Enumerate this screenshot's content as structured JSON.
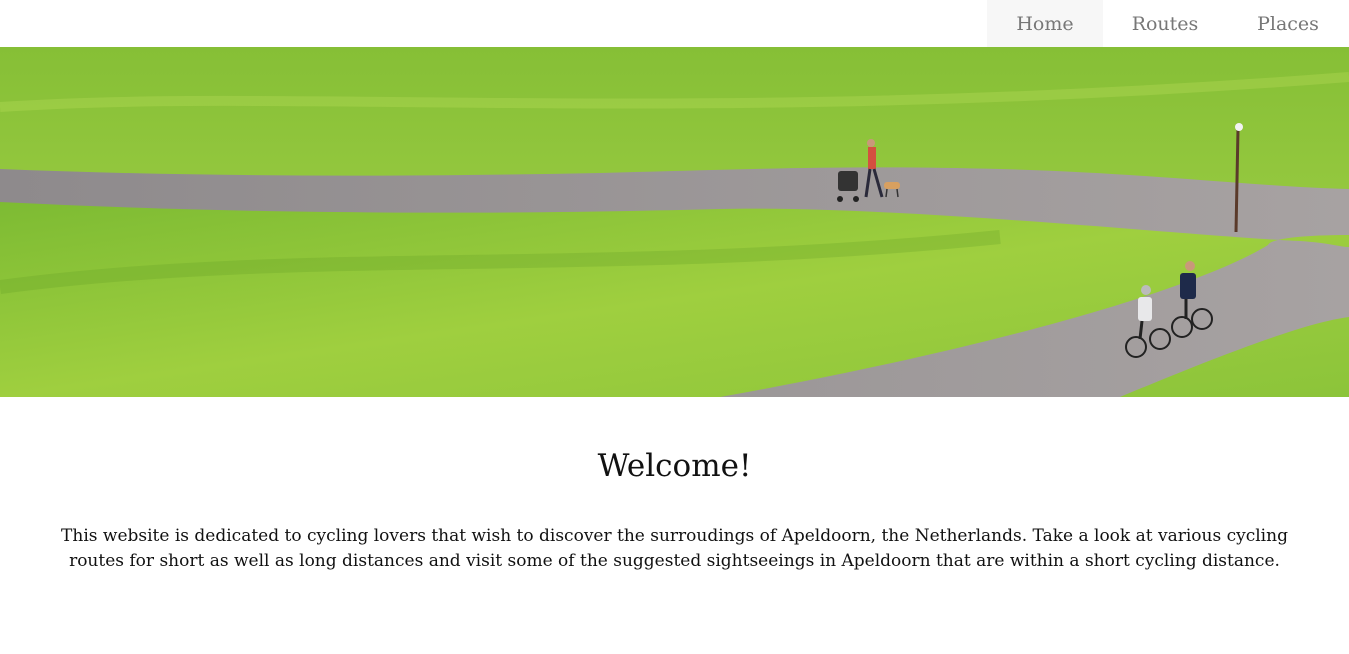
{
  "nav": {
    "items": [
      {
        "label": "Home",
        "active": true
      },
      {
        "label": "Routes",
        "active": false
      },
      {
        "label": "Places",
        "active": false
      }
    ]
  },
  "hero": {
    "image": "grass-hills-bike-path-photo",
    "colors": {
      "grass_light": "#9fcf3f",
      "grass_dark": "#6aa52a",
      "path": "#9b9596"
    }
  },
  "main": {
    "title": "Welcome!",
    "intro": "This website is dedicated to cycling lovers that wish to discover the surroudings of Apeldoorn, the Netherlands. Take a look at various cycling routes for short as well as long distances and visit some of the suggested sightseeings in Apeldoorn that are within a short cycling distance."
  }
}
